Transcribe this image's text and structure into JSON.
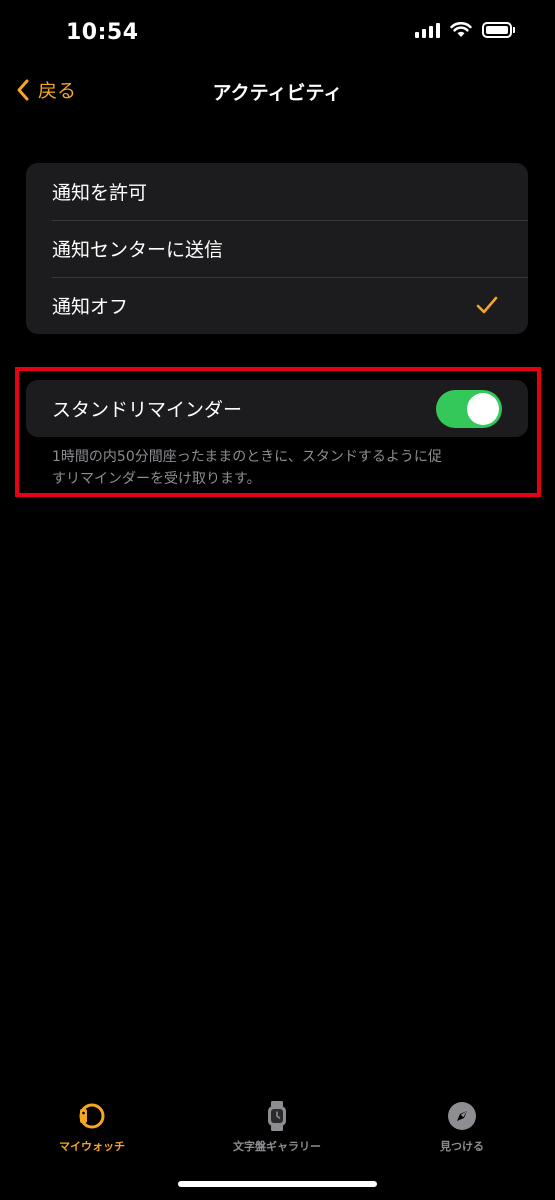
{
  "status_bar": {
    "time": "10:54"
  },
  "nav": {
    "back_label": "戻る",
    "title": "アクティビティ"
  },
  "notifications": {
    "options": [
      {
        "label": "通知を許可",
        "selected": false
      },
      {
        "label": "通知センターに送信",
        "selected": false
      },
      {
        "label": "通知オフ",
        "selected": true
      }
    ]
  },
  "stand_reminder": {
    "label": "スタンドリマインダー",
    "enabled": true,
    "footnote_line1": "1時間の内50分間座ったままのときに、スタンドするように促",
    "footnote_line2": "すリマインダーを受け取ります。"
  },
  "tab_bar": {
    "tabs": [
      {
        "label": "マイウォッチ",
        "icon": "watch-icon",
        "active": true
      },
      {
        "label": "文字盤ギャラリー",
        "icon": "watch-face-icon",
        "active": false
      },
      {
        "label": "見つける",
        "icon": "compass-icon",
        "active": false
      }
    ]
  },
  "colors": {
    "accent": "#f5a623",
    "toggle_on": "#34c759",
    "highlight": "#e60012"
  }
}
